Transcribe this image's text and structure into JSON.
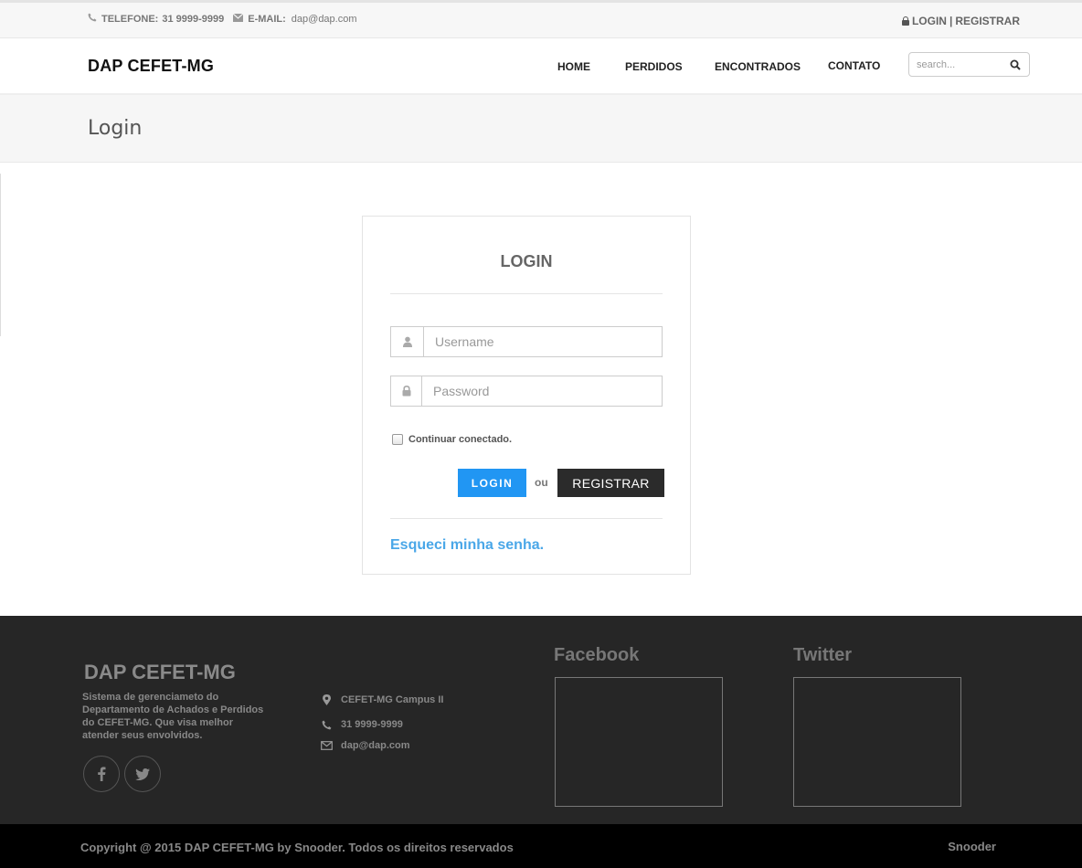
{
  "topbar": {
    "phone_label": "TELEFONE:",
    "phone": "31 9999-9999",
    "email_label": "E-MAIL:",
    "email": "dap@dap.com",
    "login_link": "LOGIN",
    "separator": "|",
    "register_link": "REGISTRAR"
  },
  "header": {
    "brand": "DAP CEFET-MG",
    "nav": [
      "HOME",
      "PERDIDOS",
      "ENCONTRADOS",
      "CONTATO"
    ],
    "search_placeholder": "search..."
  },
  "page_title": "Login",
  "login_panel": {
    "heading": "LOGIN",
    "username_placeholder": "Username",
    "password_placeholder": "Password",
    "remember_label": "Continuar conectado.",
    "login_button": "LOGIN",
    "or_text": "ou",
    "register_button": "REGISTRAR",
    "forgot_link": "Esqueci minha senha."
  },
  "footer": {
    "brand": "DAP CEFET-MG",
    "description": "Sistema de gerenciameto do Departamento de Achados e Perdidos do CEFET-MG. Que visa melhor atender seus envolvidos.",
    "social": [
      "facebook-icon",
      "twitter-icon"
    ],
    "address": "CEFET-MG Campus II",
    "phone": "31 9999-9999",
    "email": "dap@dap.com",
    "facebook_title": "Facebook",
    "twitter_title": "Twitter"
  },
  "bottombar": {
    "copyright": "Copyright @ 2015 DAP CEFET-MG by Snooder. Todos os direitos reservados",
    "credit": "Snooder"
  },
  "colors": {
    "accent": "#2196f3",
    "link": "#4aa7e8",
    "dark_button": "#2b2b2b",
    "footer_bg": "#262626"
  }
}
